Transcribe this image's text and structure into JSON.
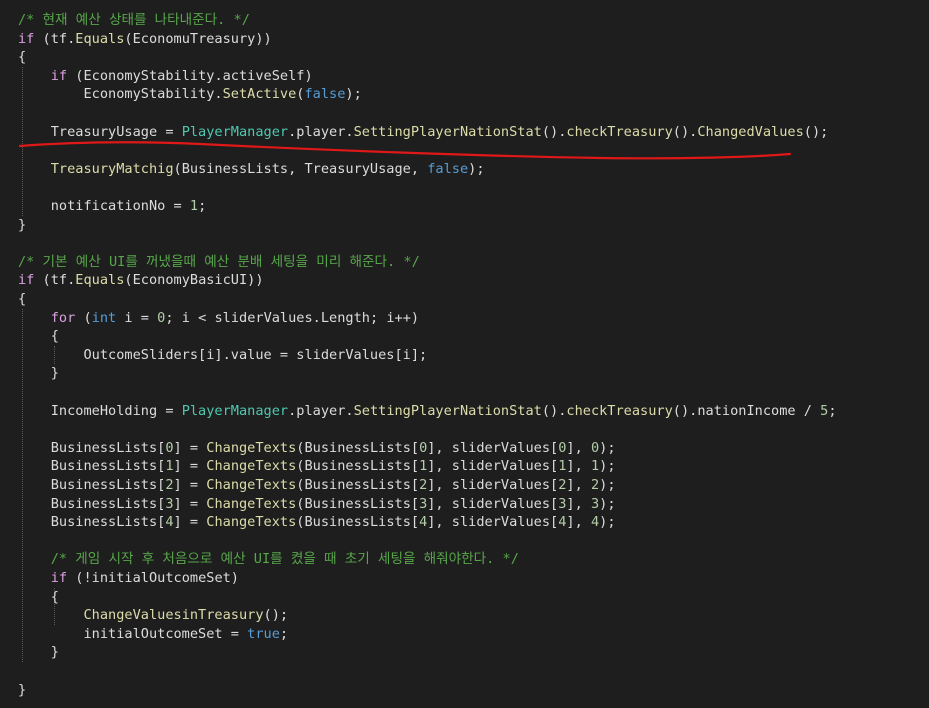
{
  "editor": {
    "theme_colors": {
      "background": "#1e1e1e",
      "keyword": "#569cd6",
      "control_keyword": "#d8a0df",
      "comment": "#57a64a",
      "type": "#4ec9b0",
      "method": "#dcdcaa",
      "number": "#b5cea8",
      "plain": "#dcdcdc",
      "annotation": "#e01818"
    },
    "lines": [
      [
        [
          "cmt",
          "/* 현재 예산 상태를 나타내준다. */"
        ]
      ],
      [
        [
          "ctl",
          "if"
        ],
        [
          "plain",
          " (tf."
        ],
        [
          "meth",
          "Equals"
        ],
        [
          "plain",
          "(EconomuTreasury))"
        ]
      ],
      [
        [
          "plain",
          "{"
        ]
      ],
      [
        [
          "plain",
          "    "
        ],
        [
          "ctl",
          "if"
        ],
        [
          "plain",
          " (EconomyStability.activeSelf)"
        ]
      ],
      [
        [
          "plain",
          "        EconomyStability."
        ],
        [
          "meth",
          "SetActive"
        ],
        [
          "plain",
          "("
        ],
        [
          "lit",
          "false"
        ],
        [
          "plain",
          ");"
        ]
      ],
      [],
      [
        [
          "plain",
          "    TreasuryUsage = "
        ],
        [
          "type",
          "PlayerManager"
        ],
        [
          "plain",
          ".player."
        ],
        [
          "meth",
          "SettingPlayerNationStat"
        ],
        [
          "plain",
          "()."
        ],
        [
          "meth",
          "checkTreasury"
        ],
        [
          "plain",
          "()."
        ],
        [
          "meth",
          "ChangedValues"
        ],
        [
          "plain",
          "();"
        ]
      ],
      [],
      [
        [
          "plain",
          "    "
        ],
        [
          "meth",
          "TreasuryMatchig"
        ],
        [
          "plain",
          "(BusinessLists, TreasuryUsage, "
        ],
        [
          "lit",
          "false"
        ],
        [
          "plain",
          ");"
        ]
      ],
      [],
      [
        [
          "plain",
          "    notificationNo = "
        ],
        [
          "num",
          "1"
        ],
        [
          "plain",
          ";"
        ]
      ],
      [
        [
          "plain",
          "}"
        ]
      ],
      [],
      [
        [
          "cmt",
          "/* 기본 예산 UI를 꺼냈을때 예산 분배 세팅을 미리 해준다. */"
        ]
      ],
      [
        [
          "ctl",
          "if"
        ],
        [
          "plain",
          " (tf."
        ],
        [
          "meth",
          "Equals"
        ],
        [
          "plain",
          "(EconomyBasicUI))"
        ]
      ],
      [
        [
          "plain",
          "{"
        ]
      ],
      [
        [
          "plain",
          "    "
        ],
        [
          "ctl",
          "for"
        ],
        [
          "plain",
          " ("
        ],
        [
          "kw",
          "int"
        ],
        [
          "plain",
          " i = "
        ],
        [
          "num",
          "0"
        ],
        [
          "plain",
          "; i < sliderValues.Length; i++)"
        ]
      ],
      [
        [
          "plain",
          "    {"
        ]
      ],
      [
        [
          "plain",
          "        OutcomeSliders[i].value = sliderValues[i];"
        ]
      ],
      [
        [
          "plain",
          "    }"
        ]
      ],
      [],
      [
        [
          "plain",
          "    IncomeHolding = "
        ],
        [
          "type",
          "PlayerManager"
        ],
        [
          "plain",
          ".player."
        ],
        [
          "meth",
          "SettingPlayerNationStat"
        ],
        [
          "plain",
          "()."
        ],
        [
          "meth",
          "checkTreasury"
        ],
        [
          "plain",
          "().nationIncome / "
        ],
        [
          "num",
          "5"
        ],
        [
          "plain",
          ";"
        ]
      ],
      [],
      [
        [
          "plain",
          "    BusinessLists["
        ],
        [
          "num",
          "0"
        ],
        [
          "plain",
          "] = "
        ],
        [
          "meth",
          "ChangeTexts"
        ],
        [
          "plain",
          "(BusinessLists["
        ],
        [
          "num",
          "0"
        ],
        [
          "plain",
          "], sliderValues["
        ],
        [
          "num",
          "0"
        ],
        [
          "plain",
          "], "
        ],
        [
          "num",
          "0"
        ],
        [
          "plain",
          ");"
        ]
      ],
      [
        [
          "plain",
          "    BusinessLists["
        ],
        [
          "num",
          "1"
        ],
        [
          "plain",
          "] = "
        ],
        [
          "meth",
          "ChangeTexts"
        ],
        [
          "plain",
          "(BusinessLists["
        ],
        [
          "num",
          "1"
        ],
        [
          "plain",
          "], sliderValues["
        ],
        [
          "num",
          "1"
        ],
        [
          "plain",
          "], "
        ],
        [
          "num",
          "1"
        ],
        [
          "plain",
          ");"
        ]
      ],
      [
        [
          "plain",
          "    BusinessLists["
        ],
        [
          "num",
          "2"
        ],
        [
          "plain",
          "] = "
        ],
        [
          "meth",
          "ChangeTexts"
        ],
        [
          "plain",
          "(BusinessLists["
        ],
        [
          "num",
          "2"
        ],
        [
          "plain",
          "], sliderValues["
        ],
        [
          "num",
          "2"
        ],
        [
          "plain",
          "], "
        ],
        [
          "num",
          "2"
        ],
        [
          "plain",
          ");"
        ]
      ],
      [
        [
          "plain",
          "    BusinessLists["
        ],
        [
          "num",
          "3"
        ],
        [
          "plain",
          "] = "
        ],
        [
          "meth",
          "ChangeTexts"
        ],
        [
          "plain",
          "(BusinessLists["
        ],
        [
          "num",
          "3"
        ],
        [
          "plain",
          "], sliderValues["
        ],
        [
          "num",
          "3"
        ],
        [
          "plain",
          "], "
        ],
        [
          "num",
          "3"
        ],
        [
          "plain",
          ");"
        ]
      ],
      [
        [
          "plain",
          "    BusinessLists["
        ],
        [
          "num",
          "4"
        ],
        [
          "plain",
          "] = "
        ],
        [
          "meth",
          "ChangeTexts"
        ],
        [
          "plain",
          "(BusinessLists["
        ],
        [
          "num",
          "4"
        ],
        [
          "plain",
          "], sliderValues["
        ],
        [
          "num",
          "4"
        ],
        [
          "plain",
          "], "
        ],
        [
          "num",
          "4"
        ],
        [
          "plain",
          ");"
        ]
      ],
      [],
      [
        [
          "plain",
          "    "
        ],
        [
          "cmt",
          "/* 게임 시작 후 처음으로 예산 UI를 켰을 때 초기 세팅을 해줘야한다. */"
        ]
      ],
      [
        [
          "plain",
          "    "
        ],
        [
          "ctl",
          "if"
        ],
        [
          "plain",
          " (!initialOutcomeSet)"
        ]
      ],
      [
        [
          "plain",
          "    {"
        ]
      ],
      [
        [
          "plain",
          "        "
        ],
        [
          "meth",
          "ChangeValuesinTreasury"
        ],
        [
          "plain",
          "();"
        ]
      ],
      [
        [
          "plain",
          "        initialOutcomeSet = "
        ],
        [
          "lit",
          "true"
        ],
        [
          "plain",
          ";"
        ]
      ],
      [
        [
          "plain",
          "    }"
        ]
      ],
      [],
      [
        [
          "plain",
          "}"
        ]
      ]
    ]
  }
}
